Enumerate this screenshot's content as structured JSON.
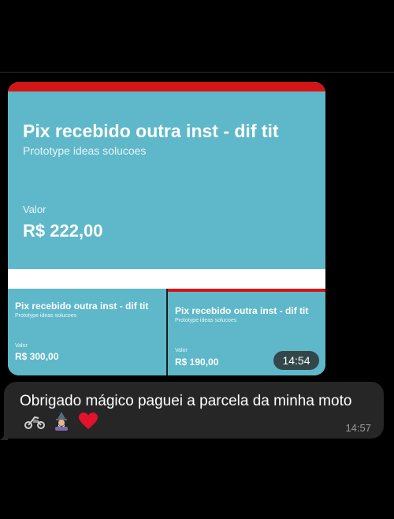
{
  "attachment": {
    "main_card": {
      "title": "Pix recebido outra inst - dif tit",
      "subtitle": "Prototype ideas solucoes",
      "value_label": "Valor",
      "amount": "R$  222,00"
    },
    "small_cards": [
      {
        "title": "Pix recebido outra inst - dif tit",
        "subtitle": "Prototype ideas solucoes",
        "value_label": "Valor",
        "amount": "R$  300,00"
      },
      {
        "title": "Pix recebido outra inst - dif tit",
        "subtitle": "Prototype ideas solucoes",
        "value_label": "Valor",
        "amount": "R$  190,00"
      }
    ],
    "timestamp": "14:54"
  },
  "message": {
    "text": "Obrigado mágico paguei a parcela da minha moto",
    "icons": [
      "motorcycle-icon",
      "wizard-icon",
      "heart-icon"
    ],
    "timestamp": "14:57"
  },
  "colors": {
    "card_bg": "#5eb8c9",
    "card_header": "#d51515",
    "bubble_bg": "#262626",
    "heart": "#e2132b"
  }
}
